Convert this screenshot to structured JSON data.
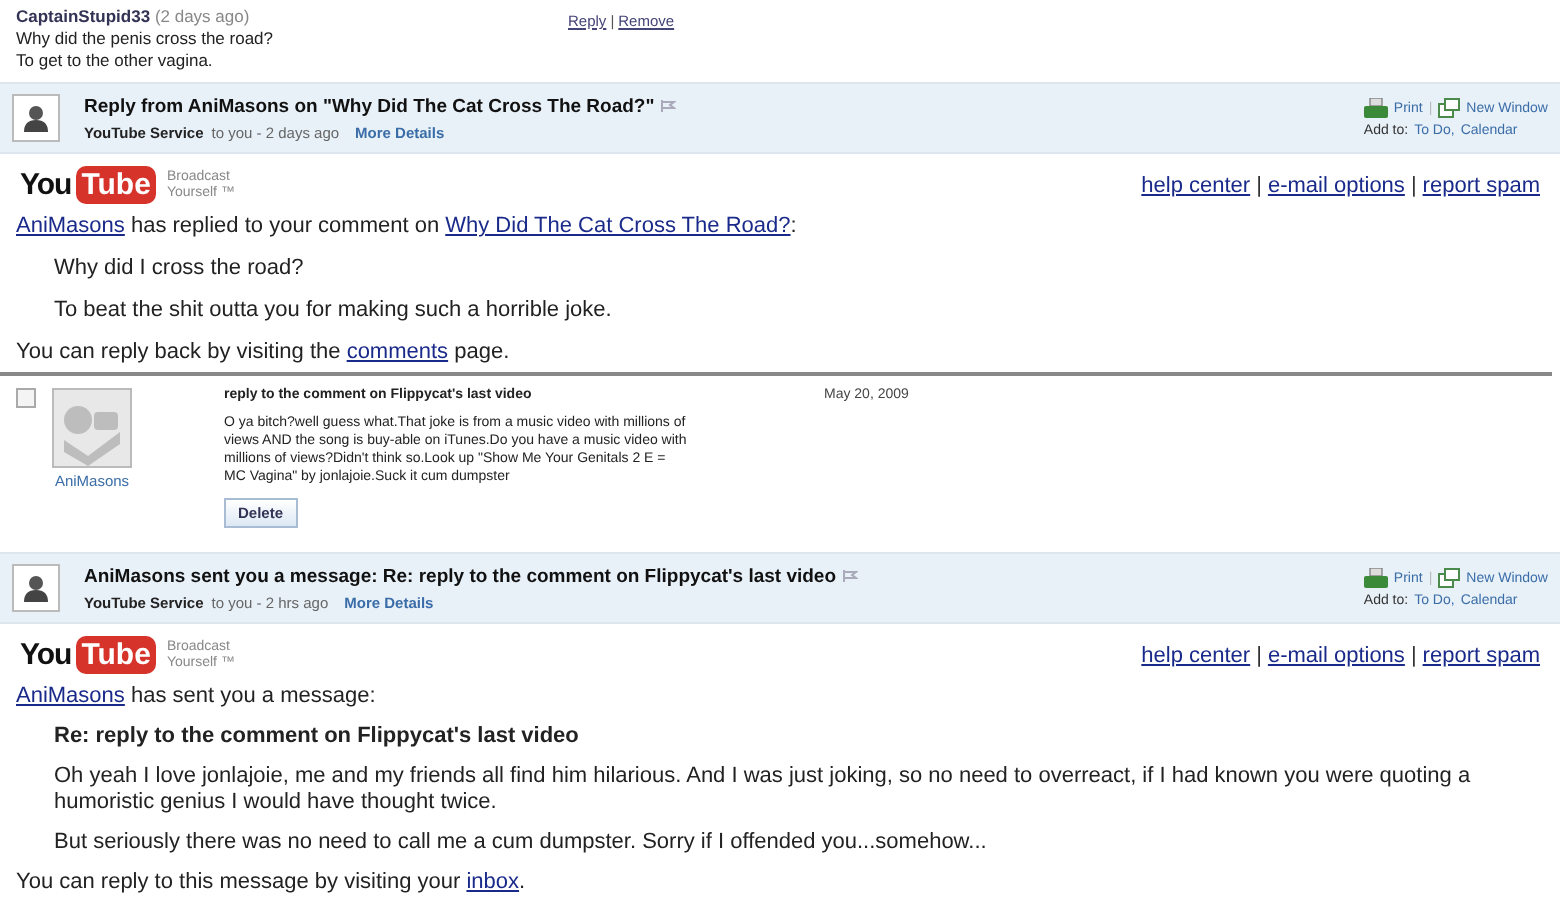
{
  "comment": {
    "author": "CaptainStupid33",
    "age": "(2 days ago)",
    "lines": [
      "Why did the penis cross the road?",
      "To get to the other vagina."
    ],
    "actions": [
      "Reply",
      "Remove"
    ],
    "separator": "|"
  },
  "email_1": {
    "header": {
      "subject": "Reply from AniMasons on \"Why Did The Cat Cross The Road?\"",
      "sender": "YouTube Service",
      "meta": "to you - 2 days ago",
      "more": "More Details",
      "print": "Print",
      "separator": "|",
      "new_window": "New Window",
      "add_to": "Add to:",
      "add_links": [
        "To Do,",
        "Calendar"
      ]
    },
    "logo": {
      "you": "You",
      "tube": "Tube",
      "tagline": [
        "Broadcast",
        "Yourself"
      ],
      "tm": "™"
    },
    "top_links": [
      "help center",
      "e-mail options",
      "report spam"
    ],
    "link_separator": "|",
    "intro": [
      {
        "kind": "link",
        "text": "AniMasons"
      },
      {
        "kind": "text",
        "text": " has replied to your comment on "
      },
      {
        "kind": "link",
        "text": "Why Did The Cat Cross The Road?"
      },
      {
        "kind": "text",
        "text": ":"
      }
    ],
    "quotes": [
      "Why did I cross the road?",
      "To beat the shit outta you for making such a horrible joke."
    ],
    "footer": [
      {
        "kind": "text",
        "text": "You can reply back by visiting the "
      },
      {
        "kind": "link",
        "text": "comments"
      },
      {
        "kind": "text",
        "text": " page."
      }
    ]
  },
  "message_card": {
    "checked": false,
    "user": "AniMasons",
    "subject": "reply to the comment on Flippycat's last video",
    "date": "May 20, 2009",
    "text": "O ya bitch?well guess what.That joke is from a music video with millions of views AND the song is buy-able on iTunes.Do you have a music video with millions of views?Didn't think so.Look up \"Show Me Your Genitals 2 E = MC Vagina\" by jonlajoie.Suck it cum dumpster",
    "button": "Delete"
  },
  "email_2": {
    "header": {
      "subject": "AniMasons sent you a message: Re: reply to the comment on Flippycat's last video",
      "sender": "YouTube Service",
      "meta": "to you - 2 hrs ago",
      "more": "More Details",
      "print": "Print",
      "separator": "|",
      "new_window": "New Window",
      "add_to": "Add to:",
      "add_links": [
        "To Do,",
        "Calendar"
      ]
    },
    "logo": {
      "you": "You",
      "tube": "Tube",
      "tagline": [
        "Broadcast",
        "Yourself"
      ],
      "tm": "™"
    },
    "top_links": [
      "help center",
      "e-mail options",
      "report spam"
    ],
    "link_separator": "|",
    "intro": [
      {
        "kind": "link",
        "text": "AniMasons"
      },
      {
        "kind": "text",
        "text": " has sent you a message:"
      }
    ],
    "title": "Re: reply to the comment on Flippycat's last video",
    "paragraphs": [
      "Oh yeah I love jonlajoie, me and my friends all find him hilarious. And I was just joking, so no need to overreact, if I had known you were quoting a humoristic genius I would have thought twice.",
      "But seriously there was no need to call me a cum dumpster. Sorry if I offended you...somehow..."
    ],
    "footer": [
      {
        "kind": "text",
        "text": "You can reply to this message by visiting your "
      },
      {
        "kind": "link",
        "text": "inbox"
      },
      {
        "kind": "text",
        "text": "."
      }
    ]
  }
}
